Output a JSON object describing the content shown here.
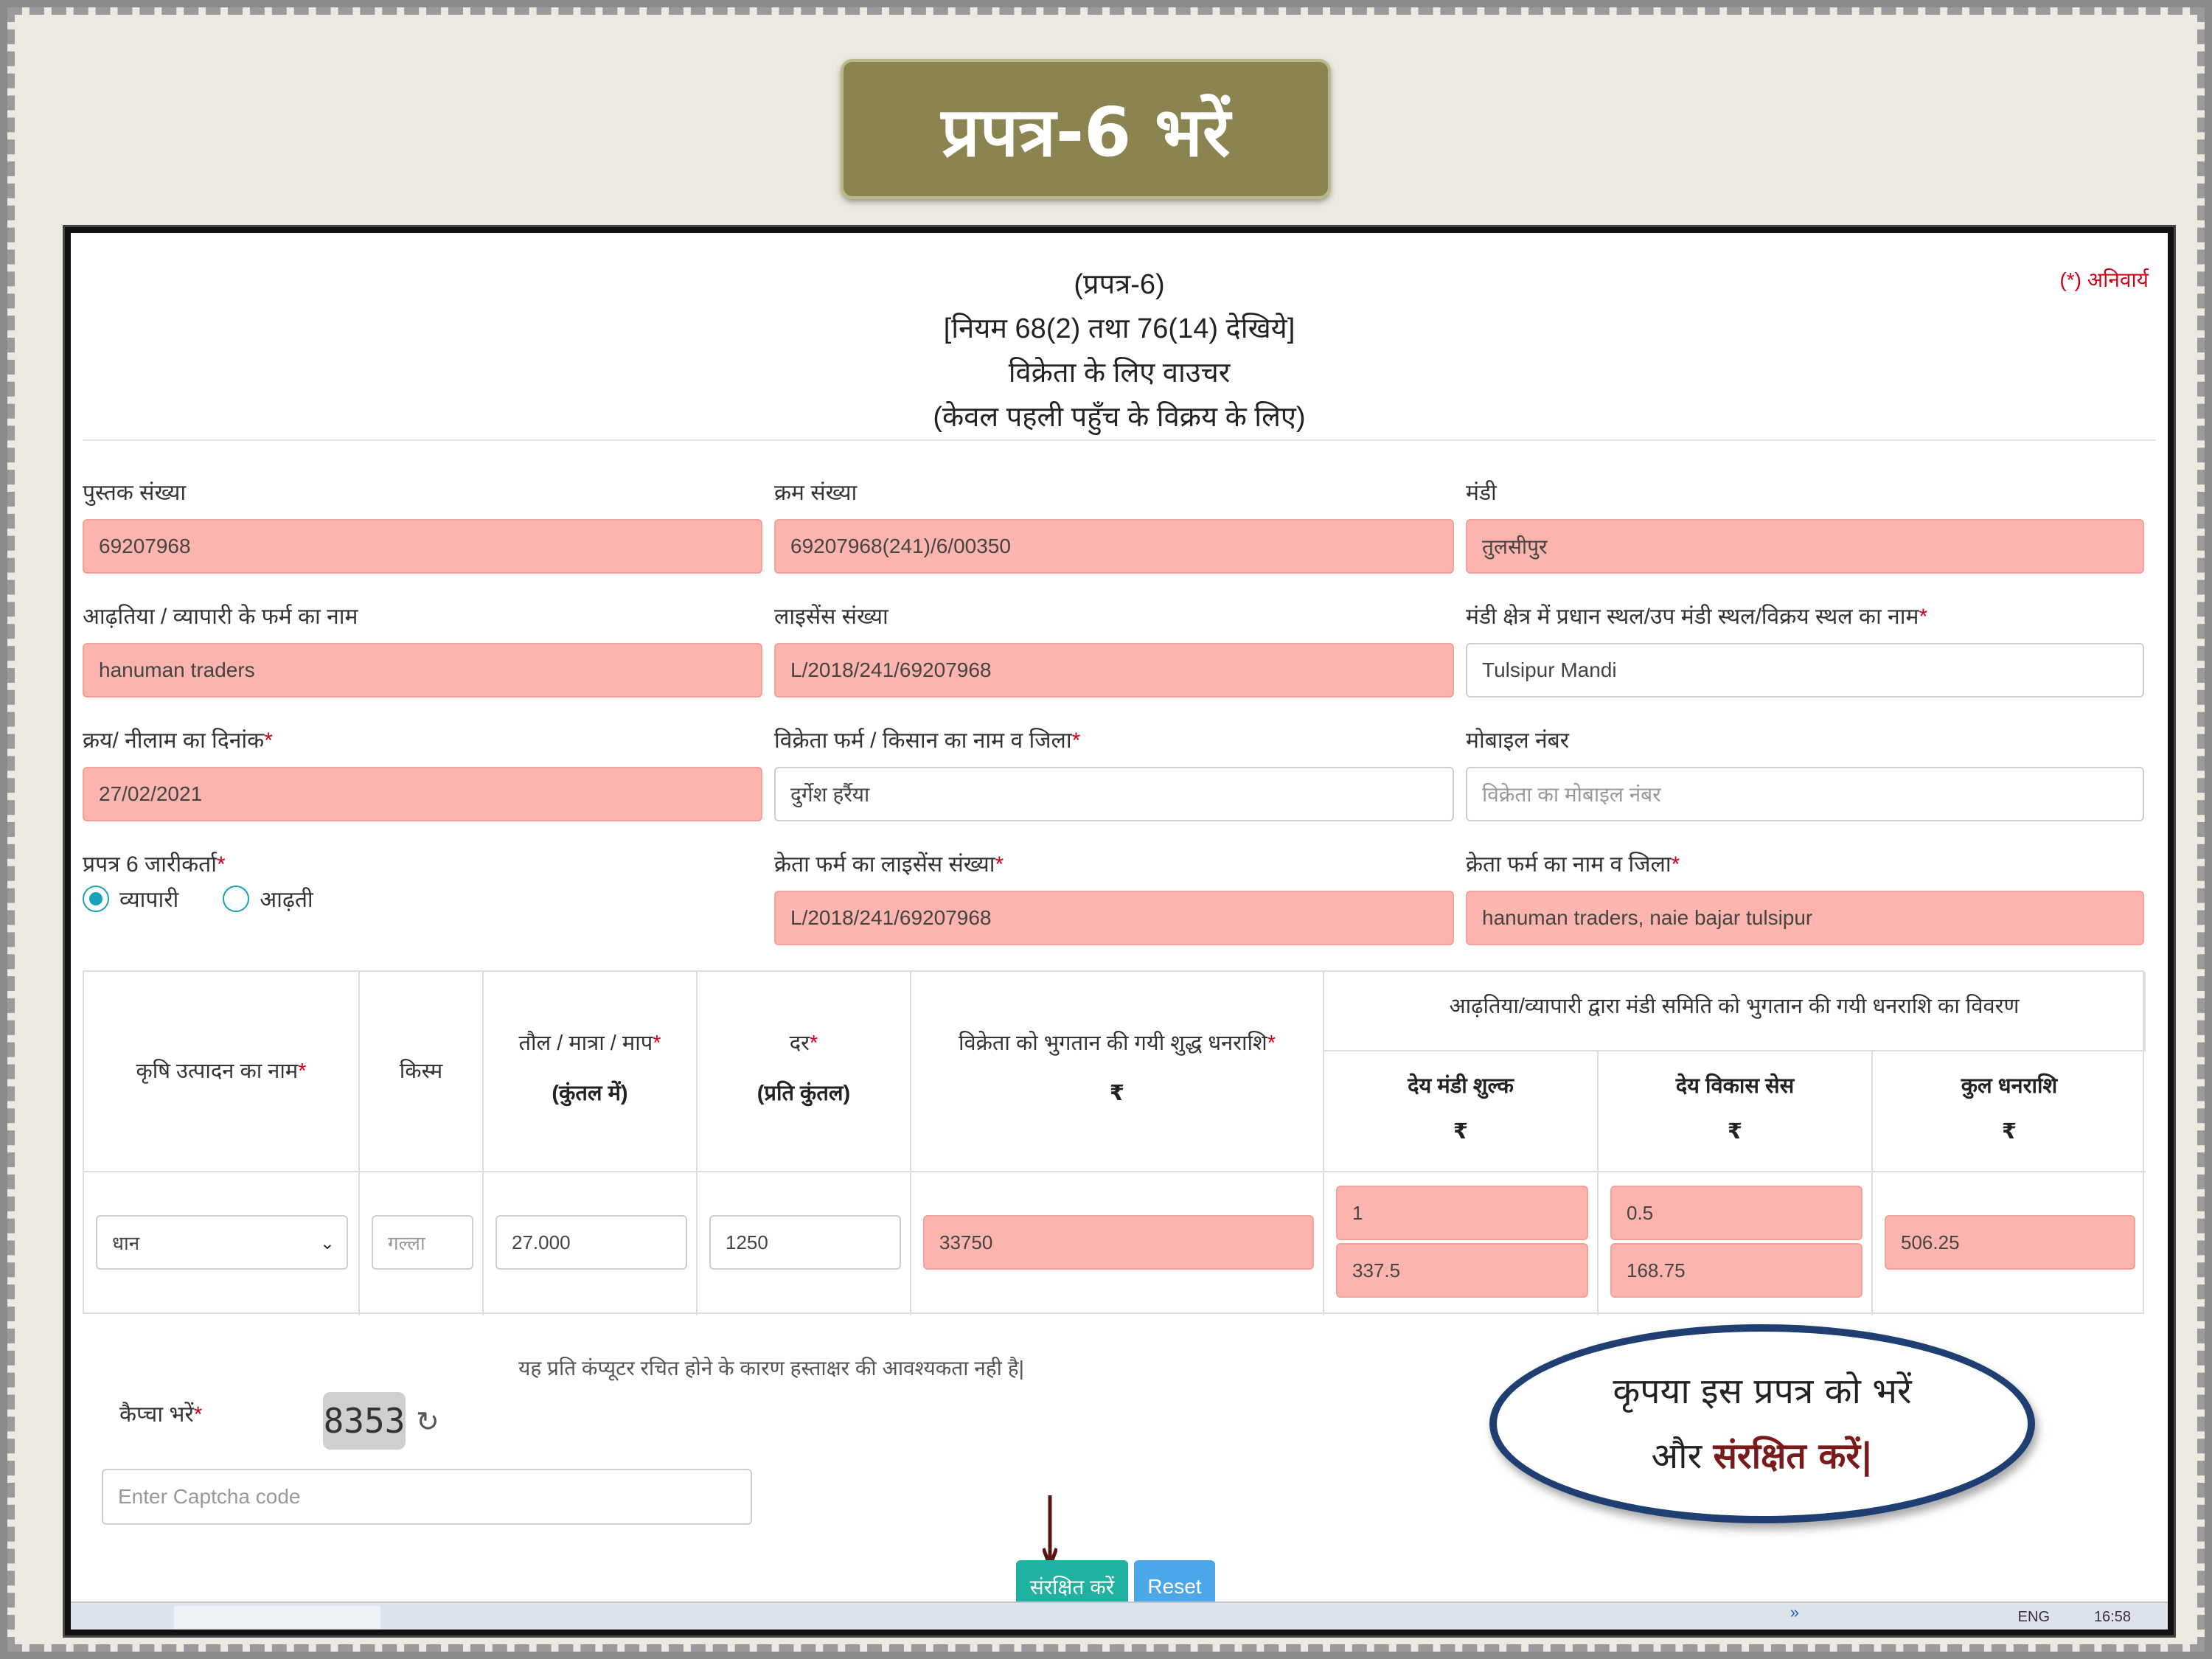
{
  "slide_title": "प्रपत्र-6 भरें",
  "form": {
    "mandatory_note": "(*) अनिवार्य",
    "heading": [
      "(प्रपत्र-6)",
      "[नियम 68(2) तथा 76(14) देखिये]",
      "विक्रेता के लिए वाउचर",
      "(केवल पहली पहुँच के विक्रय के लिए)"
    ],
    "fields": {
      "book_number": {
        "label": "पुस्तक संख्या",
        "value": "69207968"
      },
      "serial_number": {
        "label": "क्रम संख्या",
        "value": "69207968(241)/6/00350"
      },
      "mandi": {
        "label": "मंडी",
        "value": "तुलसीपुर"
      },
      "firm_name": {
        "label": "आढ़तिया / व्यापारी के फर्म का नाम",
        "value": "hanuman traders"
      },
      "license_number": {
        "label": "लाइसेंस संख्या",
        "value": "L/2018/241/69207968"
      },
      "place_name": {
        "label": "मंडी क्षेत्र में प्रधान स्थल/उप मंडी स्थल/विक्रय स्थल का नाम",
        "value": "Tulsipur Mandi"
      },
      "auction_date": {
        "label": "क्रय/ नीलाम का दिनांक",
        "value": "27/02/2021"
      },
      "seller_name": {
        "label": "विक्रेता फर्म / किसान का नाम व जिला",
        "value": "दुर्गेश हर्रैया"
      },
      "mobile": {
        "label": "मोबाइल नंबर",
        "placeholder": "विक्रेता का मोबाइल नंबर"
      },
      "issuer": {
        "label": "प्रपत्र 6 जारीकर्ता",
        "options": [
          "व्यापारी",
          "आढ़ती"
        ],
        "selected": "व्यापारी"
      },
      "buyer_license": {
        "label": "क्रेता फर्म का लाइसेंस संख्या",
        "value": "L/2018/241/69207968"
      },
      "buyer_name": {
        "label": "क्रेता फर्म का नाम व जिला",
        "value": "hanuman traders, naie bajar tulsipur"
      }
    },
    "table": {
      "headers": {
        "produce": "कृषि उत्पादन का नाम",
        "variety": "किस्म",
        "quantity": "तौल / मात्रा / माप",
        "quantity_unit": "(कुंतल में)",
        "rate": "दर",
        "rate_unit": "(प्रति कुंतल)",
        "net_amount": "विक्रेता को भुगतान की गयी शुद्ध धनराशि",
        "net_amount_unit": "₹",
        "group": "आढ़तिया/व्यापारी द्वारा मंडी समिति को भुगतान की गयी धनराशि का विवरण",
        "mandi_fee": "देय मंडी शुल्क",
        "mandi_fee_unit": "₹",
        "dev_cess": "देय विकास सेस",
        "dev_cess_unit": "₹",
        "total": "कुल धनराशि",
        "total_unit": "₹"
      },
      "row": {
        "produce": "धान",
        "variety_placeholder": "गल्ला",
        "quantity": "27.000",
        "rate": "1250",
        "net_amount": "33750",
        "mandi_fee_rate": "1",
        "mandi_fee_amount": "337.5",
        "dev_cess_rate": "0.5",
        "dev_cess_amount": "168.75",
        "total": "506.25"
      }
    },
    "footer_note": "यह प्रति कंप्यूटर रचित होने के कारण हस्ताक्षर की आवश्यकता नही है|",
    "captcha": {
      "label": "कैप्चा भरें",
      "code": "8353",
      "placeholder": "Enter Captcha code"
    },
    "buttons": {
      "save": "संरक्षित करें",
      "reset": "Reset"
    }
  },
  "taskbar": {
    "lang": "ENG",
    "time": "16:58",
    "chevron": "»"
  },
  "callout": {
    "line1": "कृपया इस प्रपत्र को भरें",
    "line2_prefix": "और ",
    "line2_emph": "संरक्षित करें|"
  },
  "colors": {
    "banner": "#8b8450",
    "pink_field": "#fbb4ae",
    "save_button": "#20b2a0",
    "reset_button": "#4aa8e8",
    "callout_border": "#1f3f72"
  }
}
